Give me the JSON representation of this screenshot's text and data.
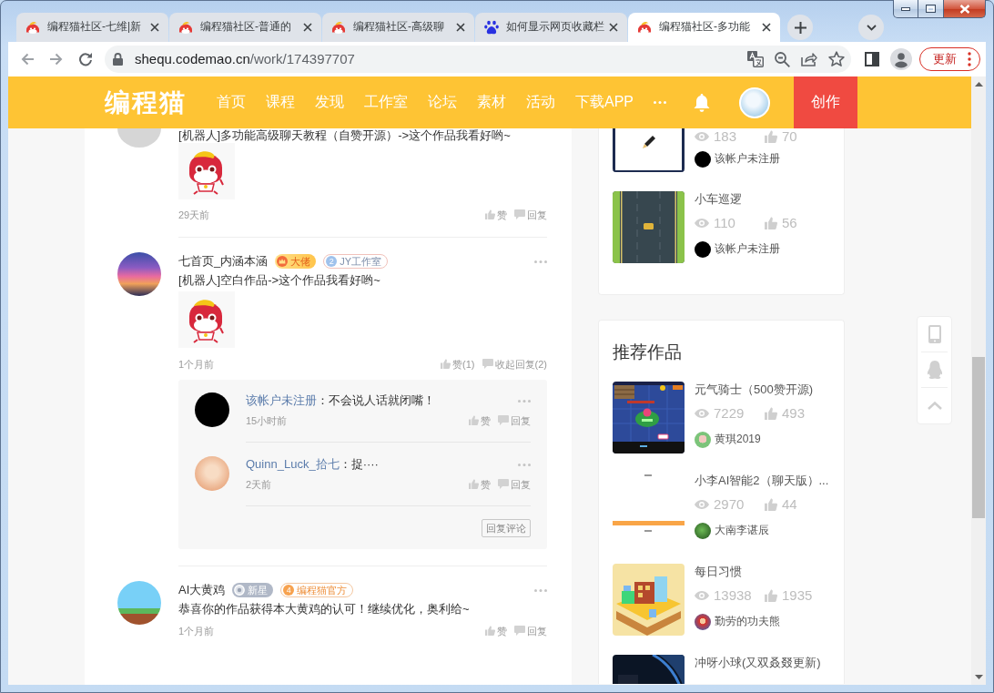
{
  "browser": {
    "tabs": [
      {
        "title": "编程猫社区-七维|新",
        "kind": "mascot",
        "selected": false
      },
      {
        "title": "编程猫社区-普通的",
        "kind": "mascot",
        "selected": false
      },
      {
        "title": "编程猫社区-高级聊",
        "kind": "mascot",
        "selected": false
      },
      {
        "title": "如何显示网页收藏栏",
        "kind": "paw",
        "selected": false
      },
      {
        "title": "编程猫社区-多功能",
        "kind": "mascot",
        "selected": true
      }
    ],
    "address": {
      "host": "shequ.codemao.cn",
      "path": "/work/174397707"
    },
    "update_button": "更新"
  },
  "site_nav": {
    "logo": "编程猫",
    "items": [
      "首页",
      "课程",
      "发现",
      "工作室",
      "论坛",
      "素材",
      "活动",
      "下载APP"
    ],
    "create_button": "创作"
  },
  "comments": [
    {
      "avatar": {
        "kind": "photo"
      },
      "text": "[机器人]多功能高级聊天教程（自赞开源）->这个作品我看好哟~",
      "sticker": true,
      "time": "29天前",
      "like": "赞",
      "reply": "回复"
    },
    {
      "avatar": {
        "kind": "galaxy"
      },
      "name": "七首页_内涵本涵",
      "badges": [
        {
          "kind": "gold",
          "text": "大佬"
        },
        {
          "kind": "studio",
          "number": "2",
          "text": "JY工作室"
        }
      ],
      "text": "[机器人]空白作品->这个作品我看好哟~",
      "sticker": true,
      "time": "1个月前",
      "like": "赞(1)",
      "reply": "收起回复(2)",
      "replies": [
        {
          "avatar": {
            "kind": "black"
          },
          "author": "该帐户未注册",
          "text": "：不会说人话就闭嘴！",
          "time": "15小时前",
          "like": "赞",
          "reply": "回复"
        },
        {
          "avatar": {
            "kind": "pig"
          },
          "author": "Quinn_Luck_拾七",
          "text": "：捉····",
          "time": "2天前",
          "like": "赞",
          "reply": "回复"
        }
      ],
      "reply_button": "回复评论"
    },
    {
      "avatar": {
        "kind": "meadow"
      },
      "name": "AI大黄鸡",
      "badges": [
        {
          "kind": "gray",
          "text": "新星"
        },
        {
          "kind": "official",
          "number": "4",
          "text": "编程猫官方"
        }
      ],
      "text": "恭喜你的作品获得本大黄鸡的认可！继续优化，奥利给~",
      "sticker": false,
      "time": "1个月前",
      "like": "赞",
      "reply": "回复"
    }
  ],
  "author_works": [
    {
      "thumbnail": {
        "kind": "pencil"
      },
      "views": "183",
      "likes": "70",
      "author": "该帐户未注册",
      "author_avatar": {
        "kind": "black"
      }
    },
    {
      "thumbnail": {
        "kind": "road"
      },
      "title": "小车巡逻",
      "views": "110",
      "likes": "56",
      "author": "该帐户未注册",
      "author_avatar": {
        "kind": "black"
      }
    }
  ],
  "recommended": {
    "title": "推荐作品",
    "works": [
      {
        "thumbnail": {
          "kind": "arena"
        },
        "title": "元气骑士（500赞开源)",
        "views": "7229",
        "likes": "493",
        "author": "黄琪2019",
        "author_avatar": {
          "kind": "mushroom"
        }
      },
      {
        "thumbnail": {
          "kind": "blank"
        },
        "title": "小李AI智能2（聊天版）...",
        "views": "2970",
        "likes": "44",
        "author": "大南李谌辰",
        "author_avatar": {
          "kind": "leaf"
        }
      },
      {
        "thumbnail": {
          "kind": "blocks"
        },
        "title": "每日习惯",
        "views": "13938",
        "likes": "1935",
        "author": "勤劳的功夫熊",
        "author_avatar": {
          "kind": "bear"
        }
      },
      {
        "thumbnail": {
          "kind": "space"
        },
        "title": "冲呀小球(又双叒叕更新)"
      }
    ]
  }
}
